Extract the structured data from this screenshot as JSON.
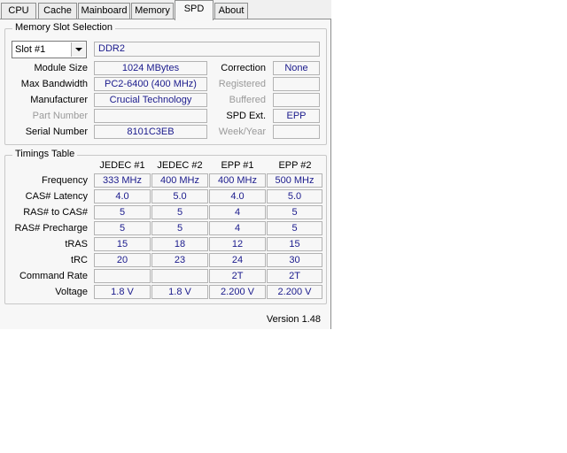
{
  "tabs": [
    {
      "label": "CPU"
    },
    {
      "label": "Cache"
    },
    {
      "label": "Mainboard"
    },
    {
      "label": "Memory"
    },
    {
      "label": "SPD"
    },
    {
      "label": "About"
    }
  ],
  "active_tab": "SPD",
  "slot_selection": {
    "legend": "Memory Slot Selection",
    "slot_value": "Slot #1",
    "memory_type": "DDR2",
    "module_size_label": "Module Size",
    "module_size": "1024 MBytes",
    "max_bandwidth_label": "Max Bandwidth",
    "max_bandwidth": "PC2-6400 (400 MHz)",
    "manufacturer_label": "Manufacturer",
    "manufacturer": "Crucial Technology",
    "part_number_label": "Part Number",
    "part_number": "",
    "serial_number_label": "Serial Number",
    "serial_number": "8101C3EB",
    "correction_label": "Correction",
    "correction": "None",
    "registered_label": "Registered",
    "registered": "",
    "buffered_label": "Buffered",
    "buffered": "",
    "spd_ext_label": "SPD Ext.",
    "spd_ext": "EPP",
    "week_year_label": "Week/Year",
    "week_year": ""
  },
  "timings": {
    "legend": "Timings Table",
    "columns": [
      "JEDEC #1",
      "JEDEC #2",
      "EPP #1",
      "EPP #2"
    ],
    "rows": [
      {
        "label": "Frequency",
        "values": [
          "333 MHz",
          "400 MHz",
          "400 MHz",
          "500 MHz"
        ]
      },
      {
        "label": "CAS# Latency",
        "values": [
          "4.0",
          "5.0",
          "4.0",
          "5.0"
        ]
      },
      {
        "label": "RAS# to CAS#",
        "values": [
          "5",
          "5",
          "4",
          "5"
        ]
      },
      {
        "label": "RAS# Precharge",
        "values": [
          "5",
          "5",
          "4",
          "5"
        ]
      },
      {
        "label": "tRAS",
        "values": [
          "15",
          "18",
          "12",
          "15"
        ]
      },
      {
        "label": "tRC",
        "values": [
          "20",
          "23",
          "24",
          "30"
        ]
      },
      {
        "label": "Command Rate",
        "values": [
          "",
          "",
          "2T",
          "2T"
        ]
      },
      {
        "label": "Voltage",
        "values": [
          "1.8 V",
          "1.8 V",
          "2.200 V",
          "2.200 V"
        ]
      }
    ]
  },
  "version": "Version 1.48",
  "colors": {
    "value_text": "#1a1a8c",
    "dim_label": "#9a9a9a",
    "border": "#8e8f8f"
  }
}
